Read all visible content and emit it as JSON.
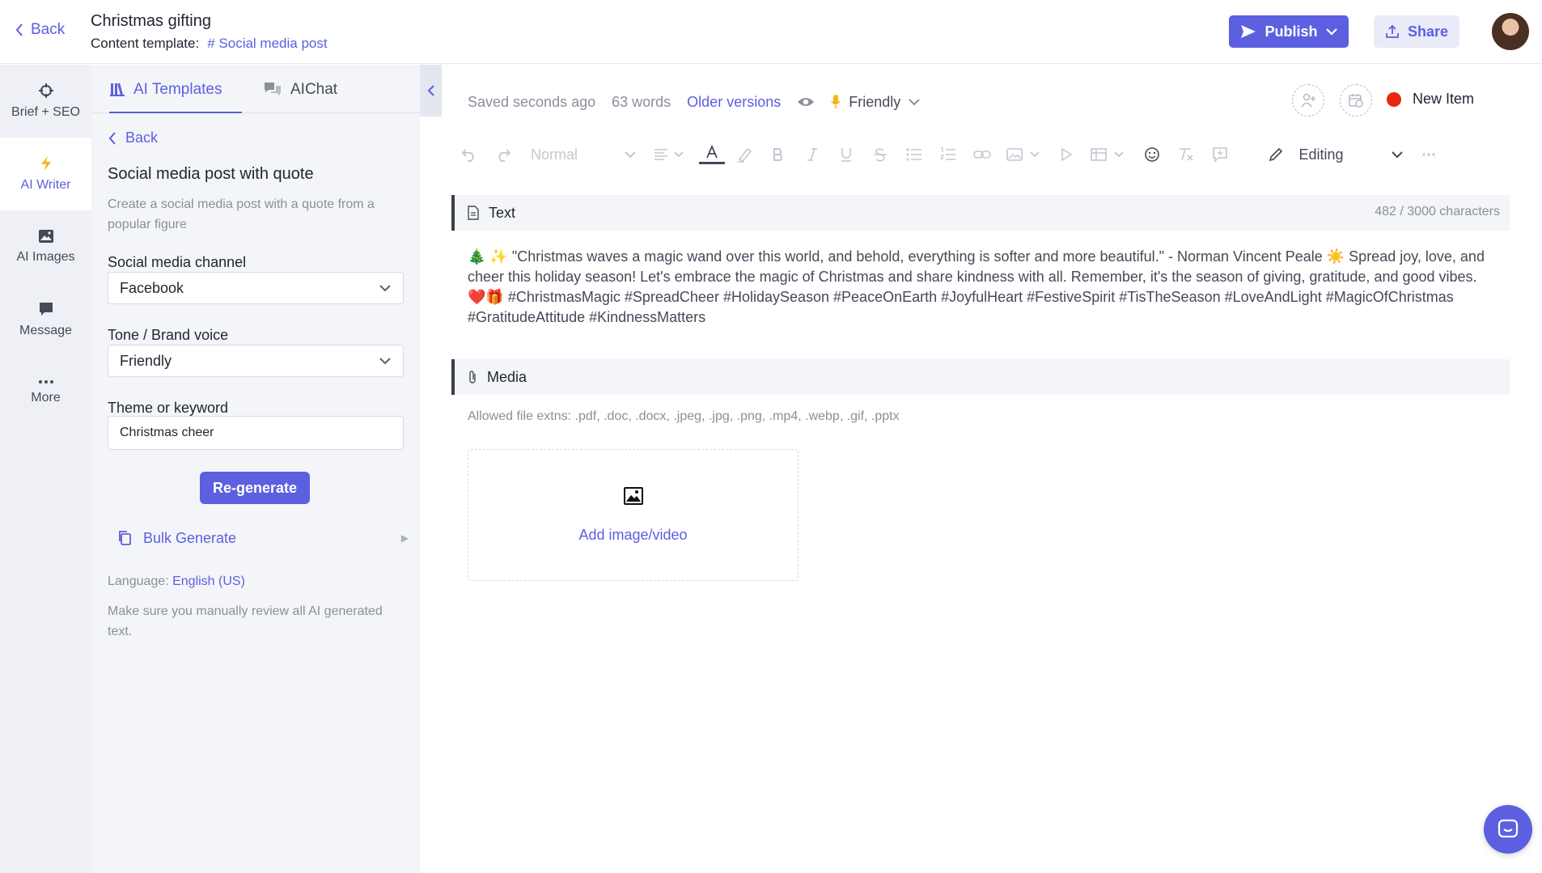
{
  "header": {
    "back_label": "Back",
    "title": "Christmas gifting",
    "template_prefix": "Content template:",
    "template_name": "Social media post",
    "publish_label": "Publish",
    "share_label": "Share"
  },
  "rail": {
    "items": [
      {
        "label": "Brief + SEO",
        "icon": "crosshair-icon"
      },
      {
        "label": "AI Writer",
        "icon": "lightning-icon"
      },
      {
        "label": "AI Images",
        "icon": "image-icon"
      },
      {
        "label": "Message",
        "icon": "message-icon"
      },
      {
        "label": "More",
        "icon": "more-icon"
      }
    ],
    "active": "AI Writer"
  },
  "panel": {
    "tabs": [
      {
        "label": "AI Templates"
      },
      {
        "label": "AIChat"
      }
    ],
    "back_label": "Back",
    "title": "Social media post with quote",
    "description": "Create a social media post with a quote from a popular figure",
    "fields": {
      "channel_label": "Social media channel",
      "channel_value": "Facebook",
      "tone_label": "Tone / Brand voice",
      "tone_value": "Friendly",
      "theme_label": "Theme or keyword",
      "theme_value": "Christmas cheer"
    },
    "regenerate_label": "Re-generate",
    "bulk_label": "Bulk Generate",
    "language_prefix": "Language:",
    "language_value": "English (US)",
    "review_note": "Make sure you manually review all AI generated text."
  },
  "editor": {
    "saved_status": "Saved seconds ago",
    "word_count": "63 words",
    "older_versions": "Older versions",
    "tone": "Friendly",
    "item_status": "New Item",
    "style_select": "Normal",
    "mode": "Editing",
    "text_section": {
      "title": "Text",
      "char_count": "482 / 3000 characters",
      "content": "🎄 ✨ \"Christmas waves a magic wand over this world, and behold, everything is softer and more beautiful.\" - Norman Vincent Peale ☀️ Spread joy, love, and cheer this holiday season! Let's embrace the magic of Christmas and share kindness with all. Remember, it's the season of giving, gratitude, and good vibes. ❤️🎁 #ChristmasMagic #SpreadCheer #HolidaySeason #PeaceOnEarth #JoyfulHeart #FestiveSpirit #TisTheSeason #LoveAndLight #MagicOfChristmas #GratitudeAttitude #KindnessMatters"
    },
    "media_section": {
      "title": "Media",
      "allowed": "Allowed file extns: .pdf, .doc, .docx, .jpeg, .jpg, .png, .mp4, .webp, .gif, .pptx",
      "add_label": "Add image/video"
    }
  },
  "colors": {
    "accent": "#5b5fe0",
    "status_new": "#e8280f",
    "rail_bg": "#eef0f5",
    "panel_bg": "#f4f5f9"
  }
}
